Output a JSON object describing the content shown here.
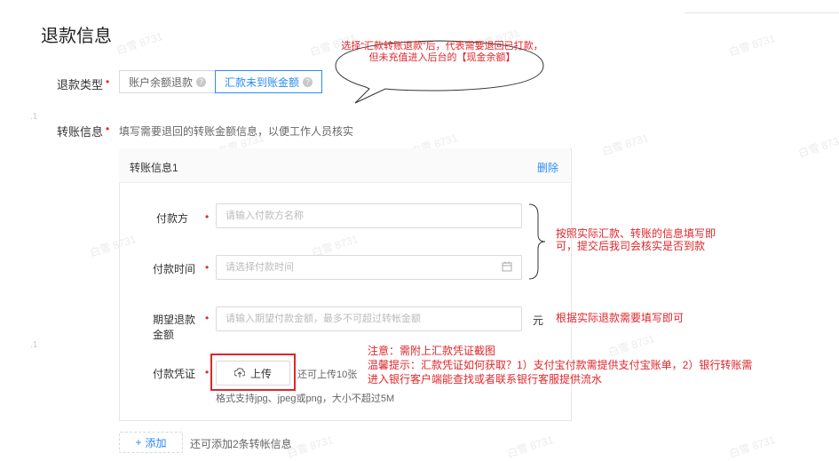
{
  "page_title": "退款信息",
  "watermark": "白雪 8731",
  "refund_type": {
    "label": "退款类型",
    "required_mark": "•",
    "options": [
      {
        "label": "账户余额退款",
        "help": "?"
      },
      {
        "label": "汇款未到账金额",
        "help": "?"
      }
    ],
    "selected": "汇款未到账金额"
  },
  "callout_bubble": "选择“汇款转账退款”后，代表需要退回已打款，但未充值进入后台的【现金余额】",
  "transfer_info": {
    "label": "转账信息",
    "required_mark": "•",
    "hint": "填写需要退回的转账金额信息，以便工作人员核实"
  },
  "card": {
    "title": "转账信息1",
    "delete_label": "删除",
    "fields": [
      {
        "label": "付款方",
        "required_mark": "•",
        "placeholder": "请输入付款方名称"
      },
      {
        "label": "付款时间",
        "required_mark": "•",
        "placeholder": "请选择付款时间",
        "icon": "calendar-icon"
      },
      {
        "label_line1": "期望退款",
        "label_line2": "金额",
        "required_mark": "•",
        "placeholder": "请输入期望付款金额，最多不可超过转帐金额",
        "unit": "元"
      }
    ],
    "voucher": {
      "label": "付款凭证",
      "required_mark": "•",
      "upload_label": "上传",
      "upload_icon": "upload-icon",
      "limit_text": "还可上传10张",
      "format_text": "格式支持jpg、jpeg或png，大小不超过5M"
    }
  },
  "add": {
    "button_label": "添加",
    "button_icon": "+",
    "remaining_text": "还可添加2条转帐信息"
  },
  "annotations": {
    "brace_note_line1": "按照实际汇款、转账的信息填写即",
    "brace_note_line2": "可，提交后我司会核实是否到款",
    "amount_note": "根据实际退款需要填写即可",
    "voucher_note_line1": "注意：需附上汇款凭证截图",
    "voucher_note_line2": "温馨提示：汇款凭证如何获取？1）支付宝付款需提供支付宝账单，2）银行转账需",
    "voucher_note_line3": "进入银行客户端能查找或者联系银行客服提供流水"
  },
  "colors": {
    "primary": "#2a8bf2",
    "annotation_red": "#e0262c",
    "border": "#d9d9d9"
  }
}
